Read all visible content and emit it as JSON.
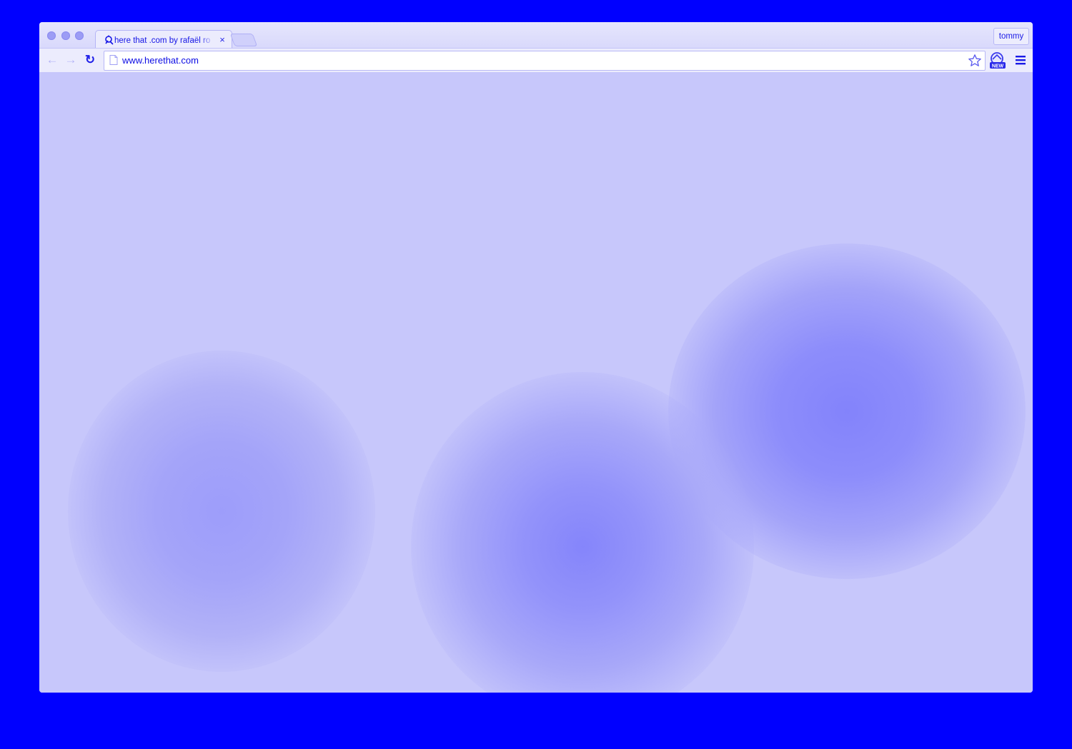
{
  "browser": {
    "tab": {
      "title": "here that .com by rafaël ro",
      "close_glyph": "×",
      "favicon": "herethat-favicon-icon"
    },
    "profile_name": "tommy",
    "toolbar": {
      "back_glyph": "←",
      "forward_glyph": "→",
      "reload_glyph": "↻",
      "url": "www.herethat.com",
      "extension_badge": "NEW",
      "icons": [
        "back-arrow-icon",
        "forward-arrow-icon",
        "reload-icon",
        "page-icon",
        "star-icon",
        "extension-new-icon",
        "hamburger-menu-icon"
      ]
    }
  },
  "colors": {
    "frame_background": "#0000ff",
    "page_background": "#c7c7fb",
    "blob_core": "#8585fb",
    "accent_text": "#0c0ce4"
  }
}
